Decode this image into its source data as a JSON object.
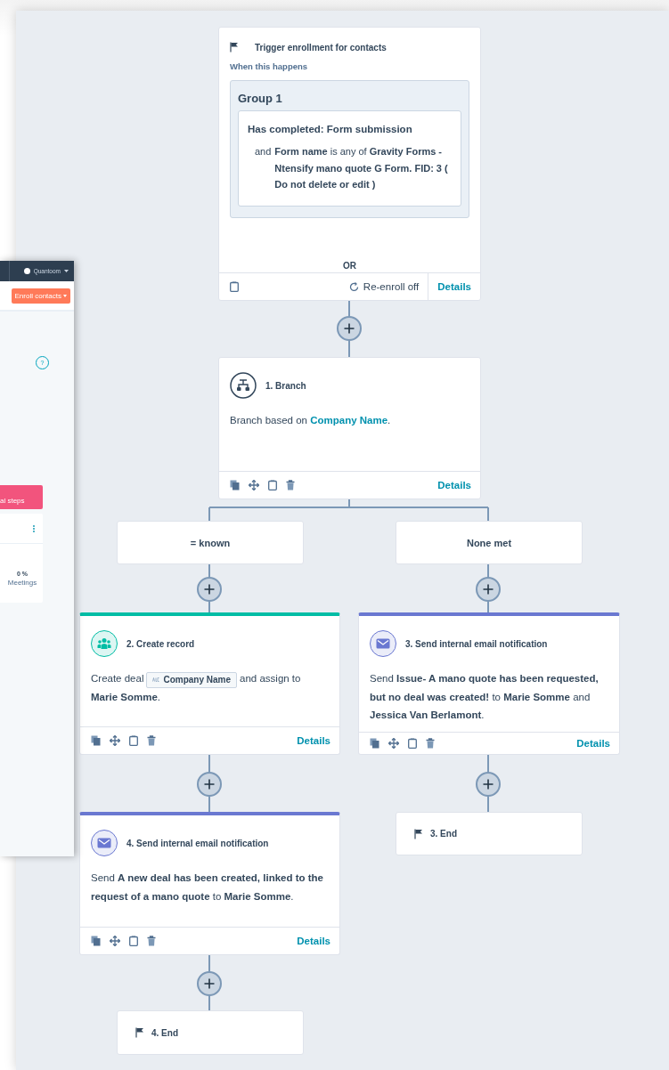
{
  "side_window": {
    "account": "Quantoom",
    "enroll_button": "Enroll contacts",
    "help": "?",
    "banner": "al steps",
    "stat_value": "0 %",
    "stat_label": "Meetings"
  },
  "nodes": [
    {
      "kind": "trigger",
      "title": "Trigger enrollment for contacts",
      "subtitle": "When this happens",
      "group": "Group 1",
      "condition_title": "Has completed: Form submission",
      "condition_prefix": "and",
      "condition": "**Form name** is any of **Gravity Forms - Ntensify mano quote G Form. FID: 3 ( Do not delete or edit )**",
      "separator": "OR",
      "reenroll": "Re-enroll off",
      "details": "Details"
    },
    {
      "kind": "branch",
      "title": "1. Branch",
      "description": "Branch based on **Company Name**.",
      "details": "Details"
    },
    {
      "kind": "label",
      "title": "= known"
    },
    {
      "kind": "label",
      "title": "None met"
    },
    {
      "kind": "record_action",
      "color": "#00bda5",
      "title": "2. Create record",
      "description_prefix": "Create deal",
      "token": "Company Name",
      "description": "and assign to **Marie Somme**.",
      "details": "Details"
    },
    {
      "kind": "email_action",
      "color": "#6a78d1",
      "title": "3. Send internal email notification",
      "description": "Send **Issue- A mano quote has been requested, but no deal was created!** to **Marie Somme** and **Jessica Van Berlamont**.",
      "details": "Details"
    },
    {
      "kind": "email_action",
      "color": "#6a78d1",
      "title": "4. Send internal email notification",
      "description": "Send **A new deal has been created, linked to the request of a mano quote** to **Marie Somme**.",
      "details": "Details"
    },
    {
      "kind": "end",
      "title": "3. End"
    },
    {
      "kind": "end",
      "title": "4. End"
    }
  ]
}
